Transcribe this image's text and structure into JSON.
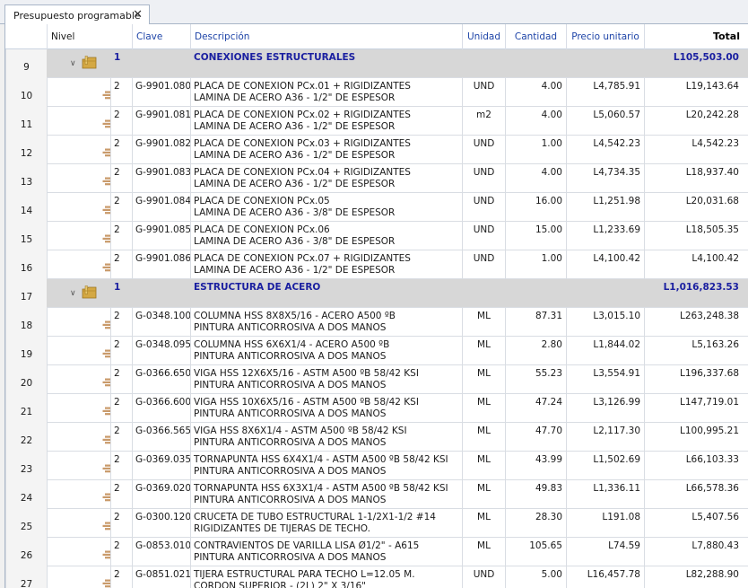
{
  "tab": {
    "title": "Presupuesto programable",
    "close": "✕"
  },
  "columns": {
    "nivel": "Nivel",
    "clave": "Clave",
    "descripcion": "Descripción",
    "unidad": "Unidad",
    "cantidad": "Cantidad",
    "precio": "Precio unitario",
    "total": "Total"
  },
  "rows": [
    {
      "num": "9",
      "type": "group",
      "level": "1",
      "desc1": "CONEXIONES ESTRUCTURALES",
      "total": "L105,503.00"
    },
    {
      "num": "10",
      "type": "item",
      "level": "2",
      "clave": "G-9901.080",
      "desc1": "PLACA DE CONEXION PCx.01 + RIGIDIZANTES",
      "desc2": "LAMINA DE ACERO A36 - 1/2\" DE ESPESOR",
      "unidad": "UND",
      "cantidad": "4.00",
      "precio": "L4,785.91",
      "total": "L19,143.64"
    },
    {
      "num": "11",
      "type": "item",
      "level": "2",
      "clave": "G-9901.081",
      "desc1": "PLACA DE CONEXION PCx.02 + RIGIDIZANTES",
      "desc2": "LAMINA DE ACERO A36 - 1/2\" DE ESPESOR",
      "unidad": "m2",
      "cantidad": "4.00",
      "precio": "L5,060.57",
      "total": "L20,242.28"
    },
    {
      "num": "12",
      "type": "item",
      "level": "2",
      "clave": "G-9901.082",
      "desc1": "PLACA DE CONEXION PCx.03 + RIGIDIZANTES",
      "desc2": "LAMINA DE ACERO A36 - 1/2\" DE ESPESOR",
      "unidad": "UND",
      "cantidad": "1.00",
      "precio": "L4,542.23",
      "total": "L4,542.23"
    },
    {
      "num": "13",
      "type": "item",
      "level": "2",
      "clave": "G-9901.083",
      "desc1": "PLACA DE CONEXION PCx.04 + RIGIDIZANTES",
      "desc2": "LAMINA DE ACERO A36 - 1/2\" DE ESPESOR",
      "unidad": "UND",
      "cantidad": "4.00",
      "precio": "L4,734.35",
      "total": "L18,937.40"
    },
    {
      "num": "14",
      "type": "item",
      "level": "2",
      "clave": "G-9901.084",
      "desc1": "PLACA DE CONEXION PCx.05",
      "desc2": "LAMINA DE ACERO A36 - 3/8\" DE ESPESOR",
      "unidad": "UND",
      "cantidad": "16.00",
      "precio": "L1,251.98",
      "total": "L20,031.68"
    },
    {
      "num": "15",
      "type": "item",
      "level": "2",
      "clave": "G-9901.085",
      "desc1": "PLACA DE CONEXION PCx.06",
      "desc2": "LAMINA DE ACERO A36 - 3/8\" DE ESPESOR",
      "unidad": "UND",
      "cantidad": "15.00",
      "precio": "L1,233.69",
      "total": "L18,505.35"
    },
    {
      "num": "16",
      "type": "item",
      "level": "2",
      "clave": "G-9901.086",
      "desc1": "PLACA DE CONEXION PCx.07 + RIGIDIZANTES",
      "desc2": "LAMINA DE ACERO A36 - 1/2\" DE ESPESOR",
      "unidad": "UND",
      "cantidad": "1.00",
      "precio": "L4,100.42",
      "total": "L4,100.42"
    },
    {
      "num": "17",
      "type": "group",
      "level": "1",
      "desc1": "ESTRUCTURA DE ACERO",
      "total": "L1,016,823.53"
    },
    {
      "num": "18",
      "type": "item",
      "level": "2",
      "clave": "G-0348.100",
      "desc1": "COLUMNA HSS 8X8X5/16 - ACERO A500 ºB",
      "desc2": "PINTURA ANTICORROSIVA A DOS MANOS",
      "unidad": "ML",
      "cantidad": "87.31",
      "precio": "L3,015.10",
      "total": "L263,248.38"
    },
    {
      "num": "19",
      "type": "item",
      "level": "2",
      "clave": "G-0348.095",
      "desc1": "COLUMNA HSS 6X6X1/4 - ACERO A500 ºB",
      "desc2": "PINTURA ANTICORROSIVA A DOS MANOS",
      "unidad": "ML",
      "cantidad": "2.80",
      "precio": "L1,844.02",
      "total": "L5,163.26"
    },
    {
      "num": "20",
      "type": "item",
      "level": "2",
      "clave": "G-0366.650",
      "desc1": "VIGA HSS 12X6X5/16 - ASTM A500 ºB 58/42 KSI",
      "desc2": "PINTURA ANTICORROSIVA A DOS MANOS",
      "unidad": "ML",
      "cantidad": "55.23",
      "precio": "L3,554.91",
      "total": "L196,337.68"
    },
    {
      "num": "21",
      "type": "item",
      "level": "2",
      "clave": "G-0366.600",
      "desc1": "VIGA HSS 10X6X5/16 - ASTM A500 ºB 58/42 KSI",
      "desc2": "PINTURA ANTICORROSIVA A DOS MANOS",
      "unidad": "ML",
      "cantidad": "47.24",
      "precio": "L3,126.99",
      "total": "L147,719.01"
    },
    {
      "num": "22",
      "type": "item",
      "level": "2",
      "clave": "G-0366.565",
      "desc1": "VIGA HSS 8X6X1/4 - ASTM A500 ºB 58/42 KSI",
      "desc2": "PINTURA ANTICORROSIVA A DOS MANOS",
      "unidad": "ML",
      "cantidad": "47.70",
      "precio": "L2,117.30",
      "total": "L100,995.21"
    },
    {
      "num": "23",
      "type": "item",
      "level": "2",
      "clave": "G-0369.035",
      "desc1": "TORNAPUNTA HSS 6X4X1/4 - ASTM A500 ºB 58/42 KSI",
      "desc2": "PINTURA ANTICORROSIVA A DOS MANOS",
      "unidad": "ML",
      "cantidad": "43.99",
      "precio": "L1,502.69",
      "total": "L66,103.33"
    },
    {
      "num": "24",
      "type": "item",
      "level": "2",
      "clave": "G-0369.020",
      "desc1": "TORNAPUNTA HSS 6X3X1/4 - ASTM A500 ºB 58/42 KSI",
      "desc2": "PINTURA ANTICORROSIVA A DOS MANOS",
      "unidad": "ML",
      "cantidad": "49.83",
      "precio": "L1,336.11",
      "total": "L66,578.36"
    },
    {
      "num": "25",
      "type": "item",
      "level": "2",
      "clave": "G-0300.120",
      "desc1": "CRUCETA DE TUBO ESTRUCTURAL 1-1/2X1-1/2 #14",
      "desc2": "RIGIDIZANTES DE TIJERAS DE TECHO.",
      "unidad": "ML",
      "cantidad": "28.30",
      "precio": "L191.08",
      "total": "L5,407.56"
    },
    {
      "num": "26",
      "type": "item",
      "level": "2",
      "clave": "G-0853.010",
      "desc1": "CONTRAVIENTOS DE VARILLA LISA Ø1/2\" - A615",
      "desc2": "PINTURA ANTICORROSIVA A DOS MANOS",
      "unidad": "ML",
      "cantidad": "105.65",
      "precio": "L74.59",
      "total": "L7,880.43"
    },
    {
      "num": "27",
      "type": "item",
      "level": "2",
      "clave": "G-0851.021",
      "desc1": "TIJERA ESTRUCTURAL PARA TECHO L=12.05 M.",
      "desc2": "CORDON SUPERIOR - (2L) 2\" X 3/16\"",
      "unidad": "UND",
      "cantidad": "5.00",
      "precio": "L16,457.78",
      "total": "L82,288.90"
    }
  ]
}
